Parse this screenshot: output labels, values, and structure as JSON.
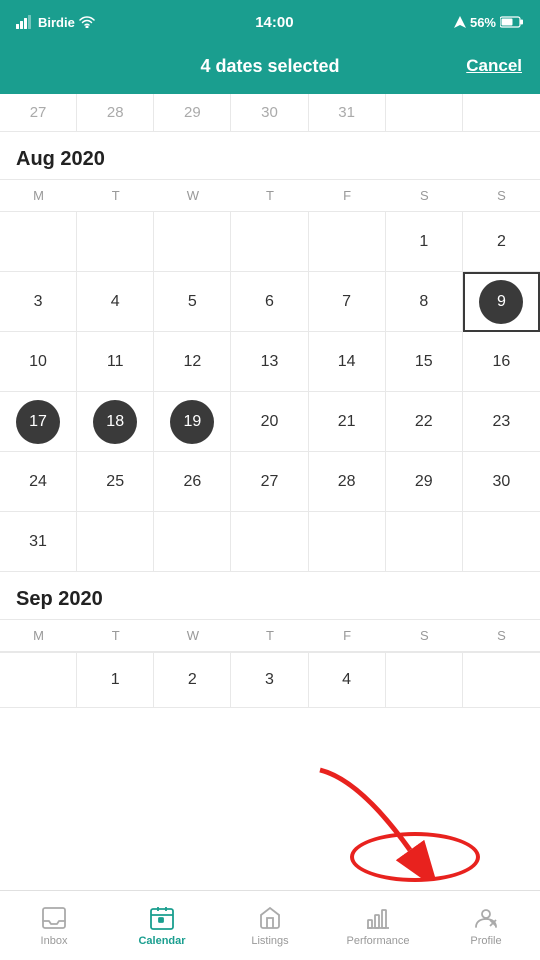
{
  "statusBar": {
    "carrier": "Birdie",
    "time": "14:00",
    "battery": "56%"
  },
  "header": {
    "title": "4 dates selected",
    "cancelLabel": "Cancel"
  },
  "prevMonthDays": [
    "27",
    "28",
    "29",
    "30",
    "31"
  ],
  "calendar": {
    "months": [
      {
        "id": "aug-2020",
        "label": "Aug 2020",
        "weekdays": [
          "M",
          "T",
          "W",
          "T",
          "F",
          "S",
          "S"
        ],
        "weeks": [
          [
            "",
            "",
            "",
            "",
            "",
            "1",
            "2"
          ],
          [
            "3",
            "4",
            "5",
            "6",
            "7",
            "8",
            "9"
          ],
          [
            "10",
            "11",
            "12",
            "13",
            "14",
            "15",
            "16"
          ],
          [
            "17",
            "18",
            "19",
            "20",
            "21",
            "22",
            "23"
          ],
          [
            "24",
            "25",
            "26",
            "27",
            "28",
            "29",
            "30"
          ],
          [
            "31",
            "",
            "",
            "",
            "",
            "",
            ""
          ]
        ],
        "selected": [
          "17",
          "18",
          "19"
        ],
        "todayBox": [
          "9"
        ]
      },
      {
        "id": "sep-2020",
        "label": "Sep 2020",
        "weekdays": [
          "M",
          "T",
          "W",
          "T",
          "F",
          "S",
          "S"
        ],
        "partialWeek": [
          "",
          "1",
          "2",
          "3",
          "4",
          "",
          ""
        ]
      }
    ]
  },
  "bottomNav": {
    "items": [
      {
        "id": "inbox",
        "label": "Inbox",
        "active": false
      },
      {
        "id": "calendar",
        "label": "Calendar",
        "active": true
      },
      {
        "id": "listings",
        "label": "Listings",
        "active": false
      },
      {
        "id": "performance",
        "label": "Performance",
        "active": false
      },
      {
        "id": "profile",
        "label": "Profile",
        "active": false
      }
    ]
  }
}
